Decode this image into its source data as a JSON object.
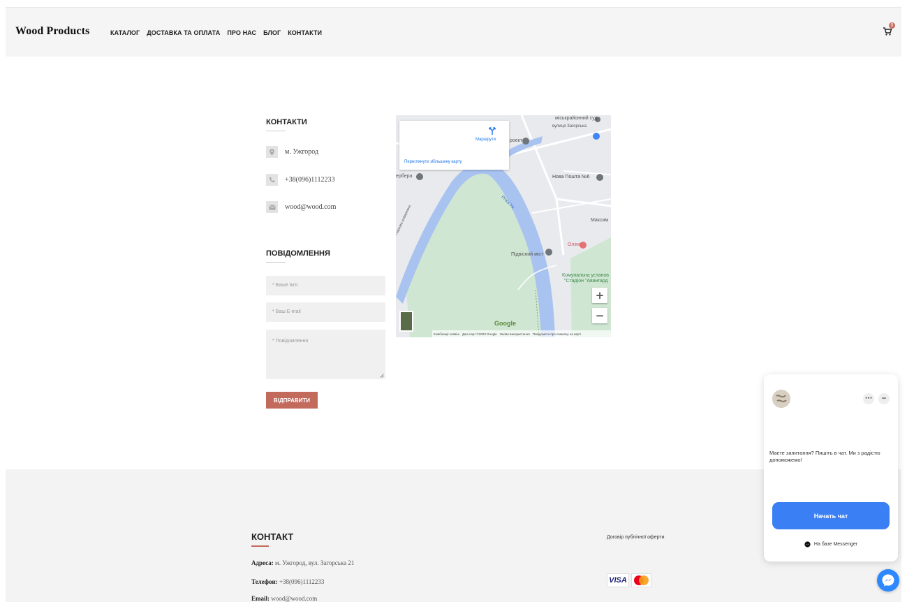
{
  "header": {
    "logo": "Wood Products",
    "nav": [
      "КАТАЛОГ",
      "ДОСТАВКА ТА ОПЛАТА",
      "ПРО НАС",
      "БЛОГ",
      "КОНТАКТИ"
    ],
    "cart_count": "0"
  },
  "contacts": {
    "title": "КОНТАКТИ",
    "city": "м. Ужгород",
    "phone": "+38(096)1112233",
    "email": "wood@wood.com",
    "icons": [
      "map-pin-icon",
      "phone-icon",
      "envelope-icon"
    ]
  },
  "message_form": {
    "title": "ПОВІДОМЛЕННЯ",
    "name_placeholder": "* Ваше ім'я",
    "email_placeholder": "* Ваш E-mail",
    "message_placeholder": "* Повідомлення",
    "submit_label": "ВІДПРАВИТИ"
  },
  "map": {
    "card_link": "Переглянути збільшену карту",
    "routes_label": "Маршрути",
    "labels": {
      "court": "міськрайонний суд",
      "street": "вулиця Загорська",
      "project": "роект",
      "erbera": "ербера",
      "nova_poshta": "Нова Пошта №6",
      "maksym": "Максим",
      "river": "Річка Уж",
      "embankment": "Паркова набережна",
      "olimp": "Олімп",
      "bridge": "Підвісний міст",
      "stadium_1": "Комунальна установ",
      "stadium_2": "\"Стадіон \"Авангард"
    },
    "google": "Google",
    "footer": [
      "Комбінації клавіш",
      "Дані карт ©2023 Google",
      "Умови використання",
      "Повідомити про помилку на карті"
    ],
    "zoom_in": "+",
    "zoom_out": "−"
  },
  "footer": {
    "title": "КОНТАКТ",
    "address_label": "Адреса:",
    "address": "м. Ужгород, вул. Загорська 21",
    "phone_label": "Телефон:",
    "phone": "+38(096)1112233",
    "email_label": "Email:",
    "email": "wood@wood.com",
    "offer_link": "Договір публічної оферти",
    "visa": "VISA",
    "mastercard": "MasterCard"
  },
  "chat": {
    "more": "···",
    "minimize": "−",
    "message": "Маєте запитання? Пишіть в чат. Ми з радістю допоможемо!",
    "start_button": "Начать чат",
    "powered": "На базе Messenger"
  },
  "colors": {
    "accent": "#c26a5c",
    "chat_button": "#3b7ff5",
    "messenger": "#2d88ff"
  }
}
